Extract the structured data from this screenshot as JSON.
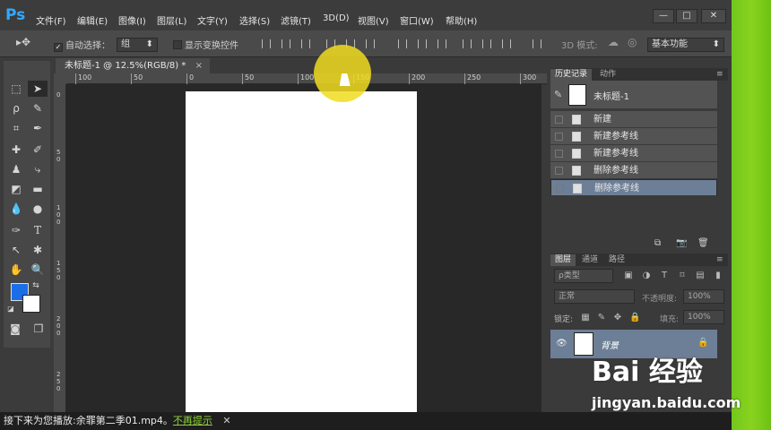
{
  "app": {
    "logo": "Ps"
  },
  "menu": [
    "文件(F)",
    "编辑(E)",
    "图像(I)",
    "图层(L)",
    "文字(Y)",
    "选择(S)",
    "滤镜(T)",
    "3D(D)",
    "视图(V)",
    "窗口(W)",
    "帮助(H)"
  ],
  "window_controls": [
    "—",
    "□",
    "✕"
  ],
  "options_bar": {
    "auto_select_label": "自动选择：",
    "auto_select_value": "组",
    "show_transform_label": "显示变换控件",
    "mode_3d_label": "3D 模式:",
    "workspace": "基本功能"
  },
  "document": {
    "tab_title": "未标题-1 @ 12.5%(RGB/8) *",
    "close": "×"
  },
  "ruler": {
    "h_labels": [
      "100",
      "50",
      "0",
      "50",
      "100",
      "150",
      "200",
      "250",
      "300"
    ],
    "v_labels": [
      "0",
      "50",
      "100",
      "150",
      "200",
      "250"
    ]
  },
  "history_panel": {
    "tabs": [
      "历史记录",
      "动作"
    ],
    "snapshot": "未标题-1",
    "items": [
      "新建",
      "新建参考线",
      "新建参考线",
      "删除参考线",
      "删除参考线"
    ],
    "selected_index": 4
  },
  "layers_panel": {
    "tabs": [
      "图层",
      "通道",
      "路径"
    ],
    "filter_kind": "ρ类型",
    "blend_mode": "正常",
    "opacity_label": "不透明度:",
    "opacity_value": "100%",
    "lock_label": "锁定:",
    "fill_label": "填充:",
    "fill_value": "100%",
    "layer_name": "背景"
  },
  "colors": {
    "foreground": "#1a6fe8",
    "background": "#ffffff",
    "selection": "#6d7f96"
  },
  "status": {
    "text": "接下来为您播放:余罪第二季01.mp4。",
    "hint": "不再提示",
    "close": "✕"
  },
  "watermark": {
    "line1": "Bai 经验",
    "line2": "jingyan.baidu.com"
  }
}
